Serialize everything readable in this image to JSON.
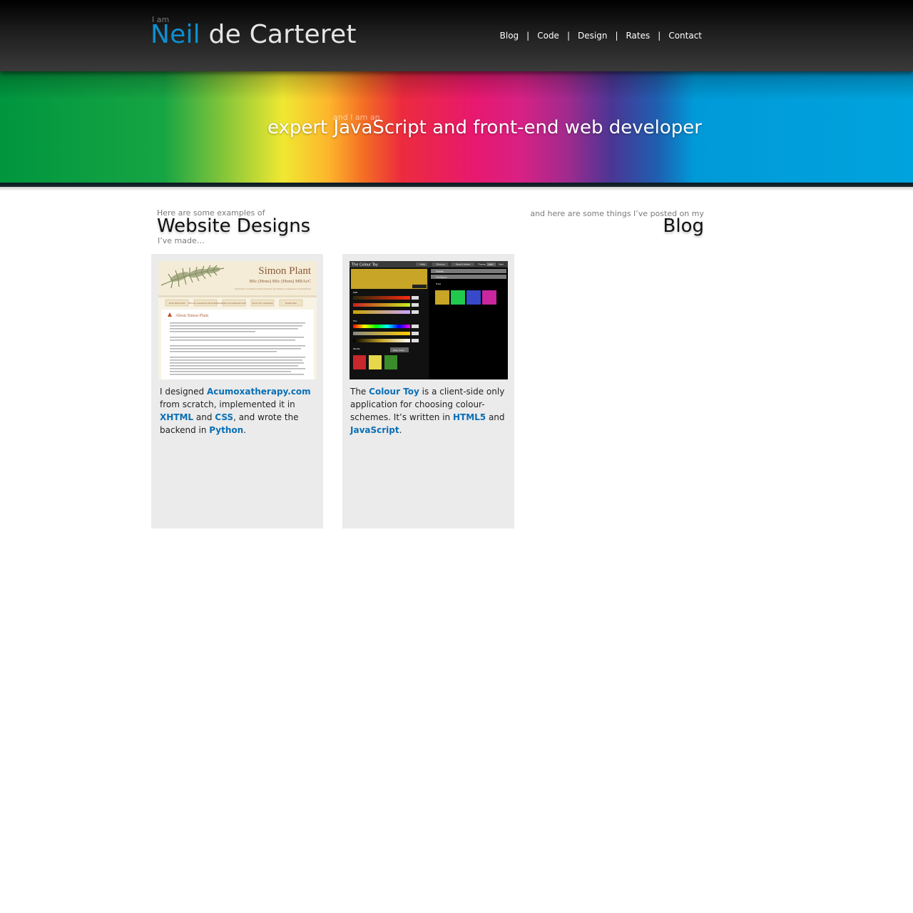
{
  "header": {
    "kicker": "I am",
    "first_name": "Neil",
    "last_name": "de Carteret",
    "nav": [
      {
        "label": "Blog"
      },
      {
        "label": "Code"
      },
      {
        "label": "Design"
      },
      {
        "label": "Rates"
      },
      {
        "label": "Contact"
      }
    ],
    "separator": "|"
  },
  "banner": {
    "kicker": "and I am an",
    "tagline": "expert JavaScript and front-end web developer"
  },
  "designs": {
    "kicker": "Here are some examples of",
    "title": "Website Designs",
    "after": "I’ve made…"
  },
  "blog": {
    "kicker": "and here are some things I’ve posted on my",
    "title": "Blog"
  },
  "cards": [
    {
      "thumbnail": {
        "title": "Simon Plant",
        "subtitle": "BSc (Hons) BSc (Hons) MBAcC",
        "tagline": "Practitioner of traditional Chinese medicine specialising in acupuncture and moxibustion",
        "tabs": [
          "About Simon Plant",
          "What are acupuncture and moxibustion?",
          "What can acupuncture treat?",
          "About your consultation",
          "Health Links"
        ],
        "heading": "About Simon Plant"
      },
      "text": {
        "t1": "I designed ",
        "l1": "Acumoxatherapy.com",
        "t2": " from scratch, implemented it in ",
        "l2": "XHTML",
        "t3": " and ",
        "l3": "CSS",
        "t4": ", and wrote the backend in ",
        "l4": "Python",
        "t5": "."
      }
    },
    {
      "thumbnail": {
        "title": "The Colour Toy",
        "toolbar": [
          "Help",
          "Discuss",
          "Save & share",
          "Theme:",
          "Light",
          "Dark"
        ],
        "groups": [
          "Shades",
          "Analogous",
          "Triad"
        ],
        "labels": [
          "RGB",
          "Red",
          "Green",
          "Blue",
          "HSL",
          "Hue",
          "Saturation",
          "Lightness",
          "Palette"
        ],
        "swatches": [
          "#c8a427",
          "#21c94c",
          "#3748c8",
          "#c8279e",
          "#c8272c",
          "#e6d84a",
          "#3a8c2a"
        ],
        "button": "Save colour"
      },
      "text": {
        "t1": "The ",
        "l1": "Colour Toy",
        "t2": " is a client-side only application for choosing colour-schemes. It’s written in ",
        "l2": "HTML5",
        "t3": " and ",
        "l3": "JavaScript",
        "t4": "."
      }
    }
  ]
}
